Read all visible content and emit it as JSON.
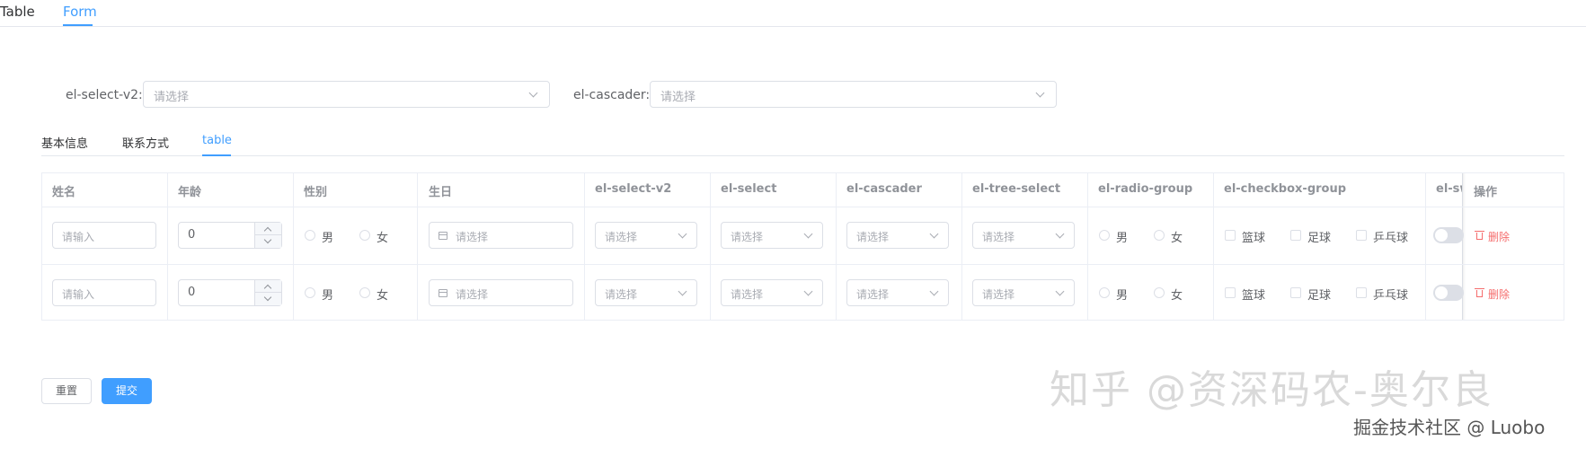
{
  "top_tabs": [
    {
      "label": "Table",
      "active": false
    },
    {
      "label": "Form",
      "active": true
    }
  ],
  "form": {
    "select_v2_label": "el-select-v2:",
    "select_v2_placeholder": "请选择",
    "cascader_label": "el-cascader:",
    "cascader_placeholder": "请选择"
  },
  "sub_tabs": [
    {
      "label": "基本信息",
      "active": false
    },
    {
      "label": "联系方式",
      "active": false
    },
    {
      "label": "table",
      "active": true
    }
  ],
  "table": {
    "headers": [
      "姓名",
      "年龄",
      "性别",
      "生日",
      "el-select-v2",
      "el-select",
      "el-cascader",
      "el-tree-select",
      "el-radio-group",
      "el-checkbox-group",
      "el-sw",
      "操作"
    ],
    "rows": [
      {
        "name_placeholder": "请输入",
        "age": "0",
        "gender_options": [
          "男",
          "女"
        ],
        "birthday_placeholder": "请选择",
        "select_v2_placeholder": "请选择",
        "select_placeholder": "请选择",
        "cascader_placeholder": "请选择",
        "tree_select_placeholder": "请选择",
        "radio_options": [
          "男",
          "女"
        ],
        "checkbox_options": [
          "篮球",
          "足球",
          "乒乓球"
        ],
        "switch_on": false,
        "delete_label": "删除"
      },
      {
        "name_placeholder": "请输入",
        "age": "0",
        "gender_options": [
          "男",
          "女"
        ],
        "birthday_placeholder": "请选择",
        "select_v2_placeholder": "请选择",
        "select_placeholder": "请选择",
        "cascader_placeholder": "请选择",
        "tree_select_placeholder": "请选择",
        "radio_options": [
          "男",
          "女"
        ],
        "checkbox_options": [
          "篮球",
          "足球",
          "乒乓球"
        ],
        "switch_on": false,
        "delete_label": "删除"
      }
    ]
  },
  "buttons": {
    "reset_label": "重置",
    "submit_label": "提交"
  },
  "watermark": {
    "main": "知乎 @资深码农-奥尔良",
    "sub": "掘金技术社区 @ Luobo"
  },
  "colors": {
    "accent": "#409eff",
    "danger": "#f56c6c",
    "border": "#dcdfe6"
  }
}
